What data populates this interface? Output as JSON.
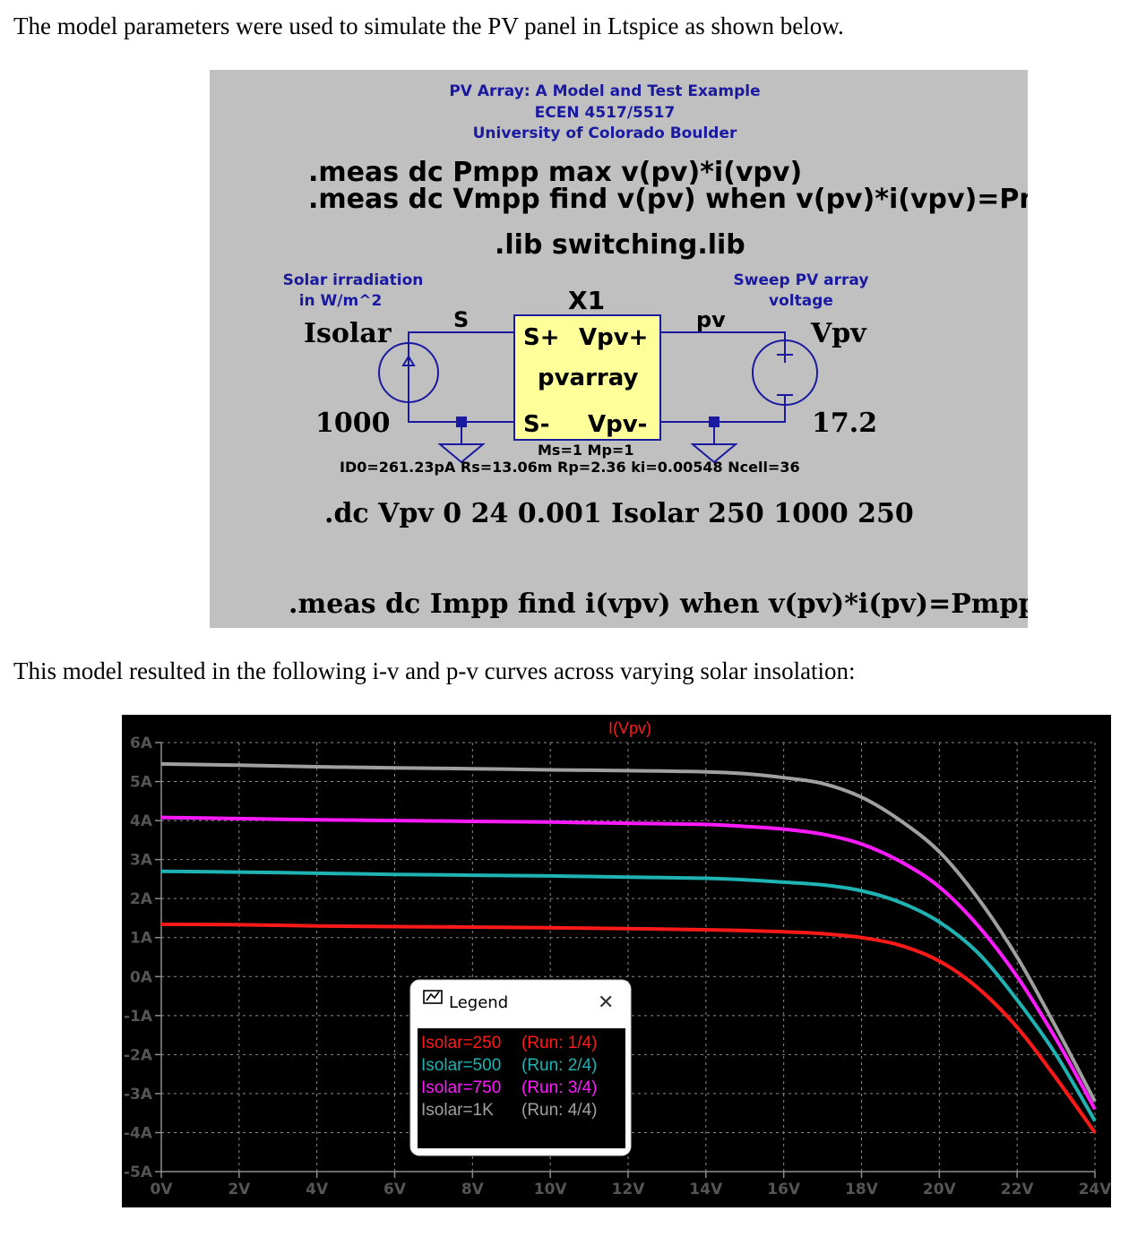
{
  "paragraphs": {
    "intro": "The model parameters were used to simulate the PV panel in Ltspice as shown below.",
    "result": "This model resulted in the following i-v and p-v curves across varying solar insolation:"
  },
  "schematic": {
    "header": [
      "PV Array: A Model and Test Example",
      "ECEN 4517/5517",
      "University of Colorado Boulder"
    ],
    "meas_pmpp": ".meas dc Pmpp max v(pv)*i(vpv)",
    "meas_vmpp": ".meas dc Vmpp find v(pv) when v(pv)*i(vpv)=Pmpp",
    "lib": ".lib switching.lib",
    "irradiation_label": [
      "Solar irradiation",
      "in W/m^2"
    ],
    "sweep_label": [
      "Sweep PV array",
      "voltage"
    ],
    "isolar_name": "Isolar",
    "isolar_value": "1000",
    "net_s": "S",
    "net_pv": "pv",
    "block_ref": "X1",
    "pin_s_plus": "S+",
    "pin_vpv_plus": "Vpv+",
    "pin_s_minus": "S-",
    "pin_vpv_minus": "Vpv-",
    "block_name": "pvarray",
    "vpv_name": "Vpv",
    "vpv_value": "17.2",
    "params_line1": "Ms=1 Mp=1",
    "params_line2": "ID0=261.23pA Rs=13.06m Rp=2.36 ki=0.00548 Ncell=36",
    "dc_cmd": ".dc Vpv 0 24 0.001 Isolar 250 1000 250",
    "meas_impp": ".meas dc Impp find i(vpv) when v(pv)*i(pv)=Pmpp"
  },
  "legend": {
    "title": "Legend",
    "close": "✕",
    "items": [
      {
        "label": "Isolar=250",
        "run": "(Run: 1/4)",
        "color": "#ff1a1a"
      },
      {
        "label": "Isolar=500",
        "run": "(Run: 2/4)",
        "color": "#1fb3b3"
      },
      {
        "label": "Isolar=750",
        "run": "(Run: 3/4)",
        "color": "#ff1aff"
      },
      {
        "label": "Isolar=1K",
        "run": "(Run: 4/4)",
        "color": "#a0a0a0"
      }
    ]
  },
  "chart_data": {
    "type": "line",
    "title": "I(Vpv)",
    "xlabel": "",
    "ylabel": "",
    "xlim": [
      0,
      24
    ],
    "ylim": [
      -5,
      6
    ],
    "grid": true,
    "background": "#000000",
    "x_ticks": [
      "0V",
      "2V",
      "4V",
      "6V",
      "8V",
      "10V",
      "12V",
      "14V",
      "16V",
      "18V",
      "20V",
      "22V",
      "24V"
    ],
    "y_ticks": [
      "6A",
      "5A",
      "4A",
      "3A",
      "2A",
      "1A",
      "0A",
      "-1A",
      "-2A",
      "-3A",
      "-4A",
      "-5A"
    ],
    "legend_position": "center-bottom",
    "x": [
      0,
      2,
      4,
      6,
      8,
      10,
      12,
      14,
      15,
      16,
      17,
      18,
      19,
      20,
      21,
      22,
      23,
      24
    ],
    "series": [
      {
        "name": "Isolar=250 (Run: 1/4)",
        "color": "#ff1a1a",
        "values": [
          1.34,
          1.33,
          1.3,
          1.28,
          1.27,
          1.25,
          1.23,
          1.2,
          1.18,
          1.15,
          1.1,
          1.0,
          0.8,
          0.4,
          -0.3,
          -1.3,
          -2.6,
          -4.0
        ]
      },
      {
        "name": "Isolar=500 (Run: 2/4)",
        "color": "#1fb3b3",
        "values": [
          2.7,
          2.68,
          2.65,
          2.62,
          2.6,
          2.58,
          2.55,
          2.52,
          2.48,
          2.42,
          2.35,
          2.2,
          1.9,
          1.4,
          0.6,
          -0.6,
          -2.0,
          -3.7
        ]
      },
      {
        "name": "Isolar=750 (Run: 3/4)",
        "color": "#ff1aff",
        "values": [
          4.08,
          4.05,
          4.02,
          4.0,
          3.98,
          3.96,
          3.93,
          3.9,
          3.85,
          3.78,
          3.65,
          3.4,
          2.95,
          2.3,
          1.3,
          0.0,
          -1.6,
          -3.4
        ]
      },
      {
        "name": "Isolar=1K (Run: 4/4)",
        "color": "#a0a0a0",
        "values": [
          5.45,
          5.42,
          5.38,
          5.35,
          5.33,
          5.3,
          5.28,
          5.25,
          5.2,
          5.1,
          4.95,
          4.6,
          4.0,
          3.2,
          2.0,
          0.5,
          -1.3,
          -3.2
        ]
      }
    ]
  }
}
